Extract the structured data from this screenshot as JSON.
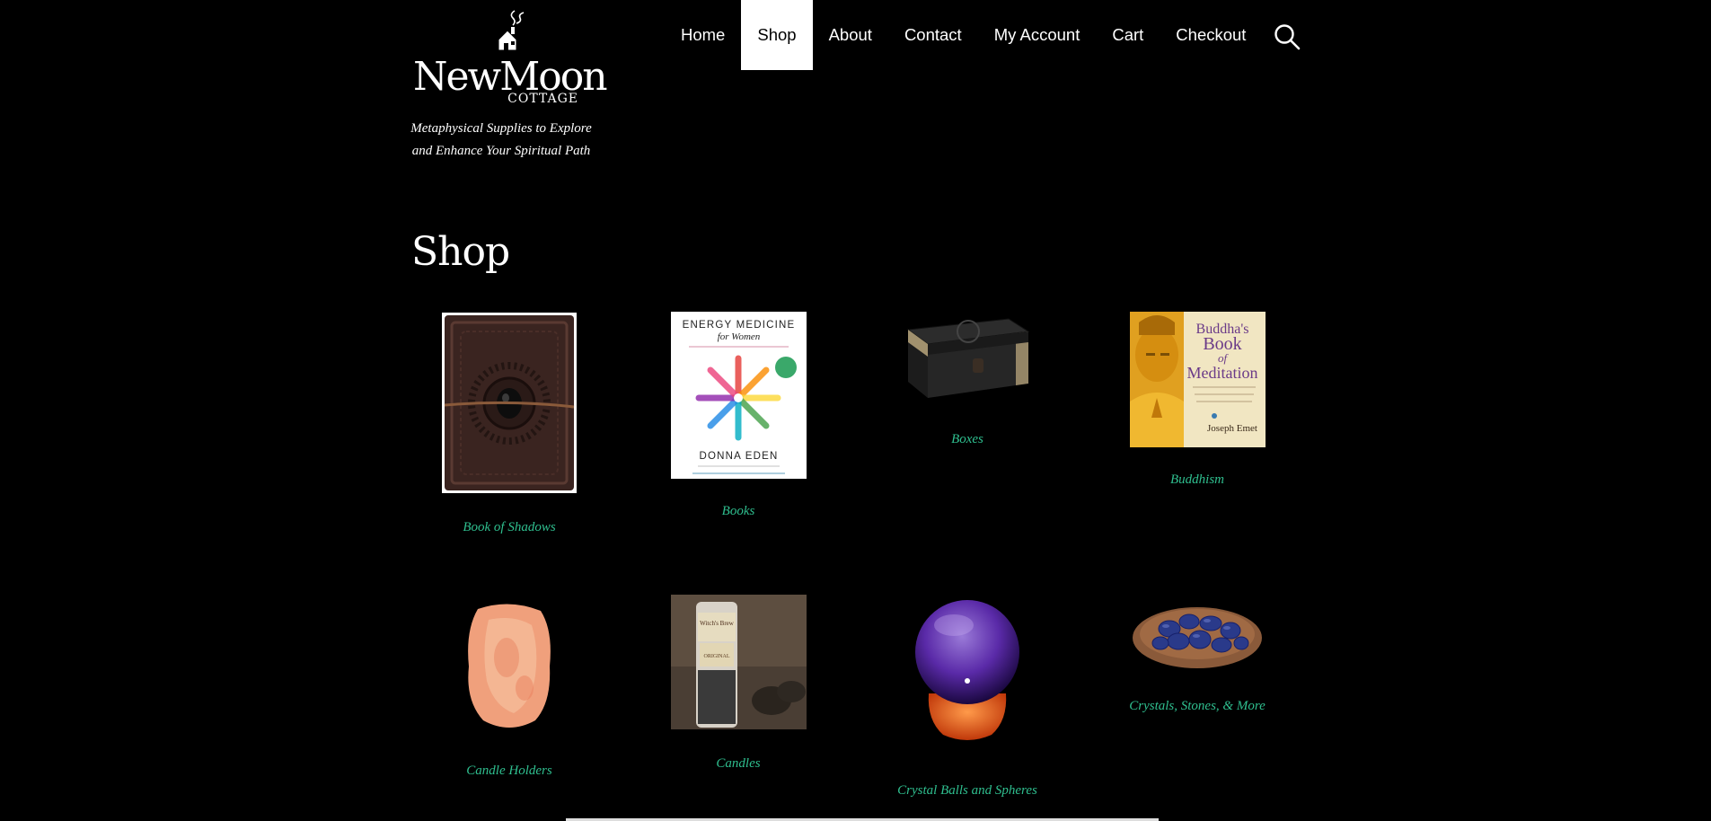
{
  "brand": {
    "name": "NewMoon",
    "sub": "COTTAGE",
    "tagline": "Metaphysical Supplies to Explore and Enhance Your Spiritual Path"
  },
  "nav": {
    "items": [
      {
        "label": "Home",
        "active": false
      },
      {
        "label": "Shop",
        "active": true
      },
      {
        "label": "About",
        "active": false
      },
      {
        "label": "Contact",
        "active": false
      },
      {
        "label": "My Account",
        "active": false
      },
      {
        "label": "Cart",
        "active": false
      },
      {
        "label": "Checkout",
        "active": false
      }
    ],
    "search_icon": "search-icon"
  },
  "page": {
    "title": "Shop"
  },
  "categories": [
    {
      "label": "Book of Shadows"
    },
    {
      "label": "Books"
    },
    {
      "label": "Boxes"
    },
    {
      "label": "Buddhism"
    },
    {
      "label": "Candle Holders"
    },
    {
      "label": "Candles"
    },
    {
      "label": "Crystal Balls and Spheres"
    },
    {
      "label": "Crystals, Stones, & More"
    }
  ],
  "book_covers": {
    "energy": {
      "title1": "ENERGY MEDICINE",
      "title2": "for Women",
      "author": "DONNA EDEN"
    },
    "buddha": {
      "title1": "Buddha's",
      "title2": "Book",
      "title3": "of",
      "title4": "Meditation",
      "author": "Joseph Emet"
    },
    "candle": {
      "label1": "Witch's Brew",
      "label2": "ORIGINAL"
    }
  },
  "colors": {
    "background": "#000000",
    "link": "#2fbf8f",
    "nav_active_bg": "#ffffff"
  }
}
